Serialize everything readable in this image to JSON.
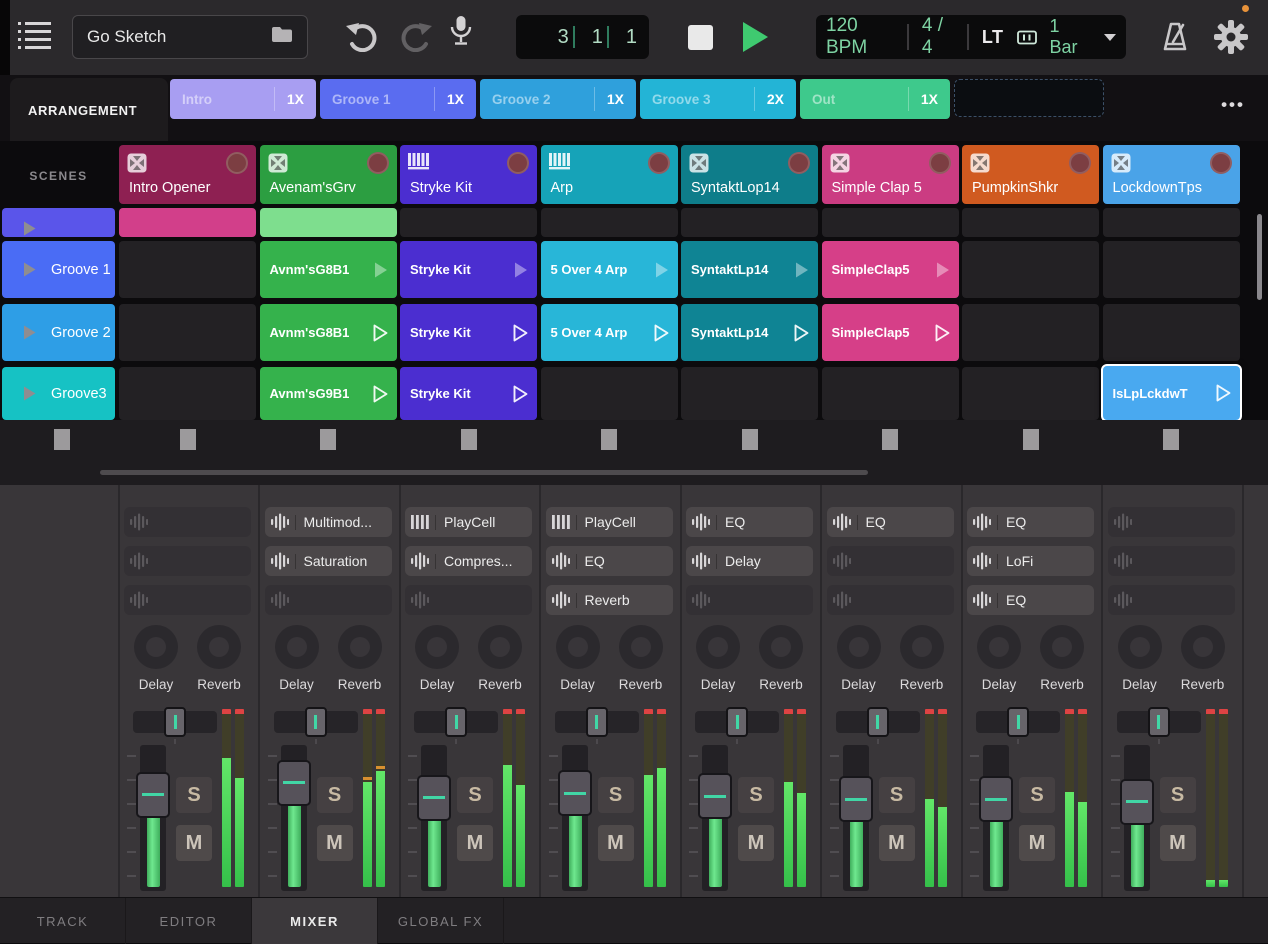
{
  "topbar": {
    "project_name": "Go Sketch",
    "position": {
      "bar": "3",
      "beat": "1",
      "sixteenth": "1"
    },
    "tempo_bpm": "120 BPM",
    "time_signature": "4 / 4",
    "launch_mode": "LT",
    "loop_length": "1 Bar",
    "accent_green": "#7ed3a3"
  },
  "arrangement": {
    "label": "ARRANGEMENT",
    "menu_label": "•••",
    "sections": [
      {
        "name": "Intro",
        "repeat": "1X",
        "color": "#a89ef2"
      },
      {
        "name": "Groove 1",
        "repeat": "1X",
        "color": "#5a6cf0"
      },
      {
        "name": "Groove 2",
        "repeat": "1X",
        "color": "#2fa0dc"
      },
      {
        "name": "Groove 3",
        "repeat": "2X",
        "color": "#23b4d6"
      },
      {
        "name": "Out",
        "repeat": "1X",
        "color": "#3ec98c"
      }
    ]
  },
  "grid": {
    "scenes_label": "SCENES",
    "scenes": [
      {
        "name": "",
        "color": "#5a55ea"
      },
      {
        "name": "Groove 1",
        "color": "#4a6cf5"
      },
      {
        "name": "Groove 2",
        "color": "#2e9ee6"
      },
      {
        "name": "Groove3",
        "color": "#16c2c4"
      }
    ],
    "tracks": [
      {
        "name": "Intro Opener",
        "color": "#8e2052",
        "icon": "pad"
      },
      {
        "name": "Avenam'sGrv",
        "color": "#2c9e41",
        "icon": "pad"
      },
      {
        "name": "Stryke Kit",
        "color": "#4b2ed0",
        "icon": "keys"
      },
      {
        "name": "Arp",
        "color": "#16a3b8",
        "icon": "keys"
      },
      {
        "name": "SyntaktLop14",
        "color": "#0e7d8a",
        "icon": "pad"
      },
      {
        "name": "Simple Clap 5",
        "color": "#cb3c82",
        "icon": "pad"
      },
      {
        "name": "PumpkinShkr",
        "color": "#d05a20",
        "icon": "pad"
      },
      {
        "name": "LockdownTps",
        "color": "#4aa3e8",
        "icon": "pad"
      }
    ],
    "rows": [
      {
        "clips": [
          {
            "track": 0,
            "name": "",
            "color": "#d23f8a",
            "tri": "none"
          },
          {
            "track": 1,
            "name": "",
            "color": "#7ede8e",
            "tri": "none"
          }
        ]
      },
      {
        "clips": [
          {
            "track": 1,
            "name": "Avnm'sG8B1",
            "color": "#35b24c",
            "tri": "filled"
          },
          {
            "track": 2,
            "name": "Stryke Kit",
            "color": "#4b2ed0",
            "tri": "filled"
          },
          {
            "track": 3,
            "name": "5 Over 4 Arp",
            "color": "#28b6d8",
            "tri": "filled"
          },
          {
            "track": 4,
            "name": "SyntaktLp14",
            "color": "#0f8494",
            "tri": "filled"
          },
          {
            "track": 5,
            "name": "SimpleClap5",
            "color": "#d63f88",
            "tri": "filled"
          }
        ]
      },
      {
        "clips": [
          {
            "track": 1,
            "name": "Avnm'sG8B1",
            "color": "#35b24c",
            "tri": "outline"
          },
          {
            "track": 2,
            "name": "Stryke Kit",
            "color": "#4b2ed0",
            "tri": "outline"
          },
          {
            "track": 3,
            "name": "5 Over 4 Arp",
            "color": "#28b6d8",
            "tri": "outline"
          },
          {
            "track": 4,
            "name": "SyntaktLp14",
            "color": "#0f8494",
            "tri": "outline"
          },
          {
            "track": 5,
            "name": "SimpleClap5",
            "color": "#d63f88",
            "tri": "outline"
          }
        ]
      },
      {
        "clips": [
          {
            "track": 1,
            "name": "Avnm'sG9B1",
            "color": "#35b24c",
            "tri": "outline"
          },
          {
            "track": 2,
            "name": "Stryke Kit",
            "color": "#4b2ed0",
            "tri": "outline"
          },
          {
            "track": 7,
            "name": "IsLpLckdwT",
            "color": "#49a9f0",
            "tri": "outline",
            "selected": true
          }
        ]
      }
    ]
  },
  "mixer": {
    "send_labels": [
      "Delay",
      "Reverb"
    ],
    "solo_label": "S",
    "mute_label": "M",
    "strips": [
      {
        "slots": [
          null,
          null,
          null
        ],
        "fader": 0.66,
        "meter": [
          0.76,
          0.64
        ]
      },
      {
        "slots": [
          {
            "label": "Multimod...",
            "icon": "fx"
          },
          {
            "label": "Saturation",
            "icon": "fx"
          },
          null
        ],
        "fader": 0.74,
        "meter": [
          0.62,
          0.68
        ],
        "orange": true
      },
      {
        "slots": [
          {
            "label": "PlayCell",
            "icon": "keys"
          },
          {
            "label": "Compres...",
            "icon": "fx"
          },
          null
        ],
        "fader": 0.64,
        "meter": [
          0.72,
          0.6
        ]
      },
      {
        "slots": [
          {
            "label": "PlayCell",
            "icon": "keys"
          },
          {
            "label": "EQ",
            "icon": "fx"
          },
          {
            "label": "Reverb",
            "icon": "fx"
          }
        ],
        "fader": 0.67,
        "meter": [
          0.66,
          0.7
        ]
      },
      {
        "slots": [
          {
            "label": "EQ",
            "icon": "fx"
          },
          {
            "label": "Delay",
            "icon": "fx"
          },
          null
        ],
        "fader": 0.65,
        "meter": [
          0.62,
          0.55
        ]
      },
      {
        "slots": [
          {
            "label": "EQ",
            "icon": "fx"
          },
          null,
          null
        ],
        "fader": 0.63,
        "meter": [
          0.52,
          0.47
        ]
      },
      {
        "slots": [
          {
            "label": "EQ",
            "icon": "fx"
          },
          {
            "label": "LoFi",
            "icon": "fx"
          },
          {
            "label": "EQ",
            "icon": "fx"
          }
        ],
        "fader": 0.63,
        "meter": [
          0.56,
          0.5
        ]
      },
      {
        "slots": [
          null,
          null,
          null
        ],
        "fader": 0.61,
        "meter": [
          0.04,
          0.04
        ]
      }
    ]
  },
  "tabs": [
    {
      "label": "TRACK"
    },
    {
      "label": "EDITOR"
    },
    {
      "label": "MIXER",
      "active": true
    },
    {
      "label": "GLOBAL FX"
    }
  ]
}
